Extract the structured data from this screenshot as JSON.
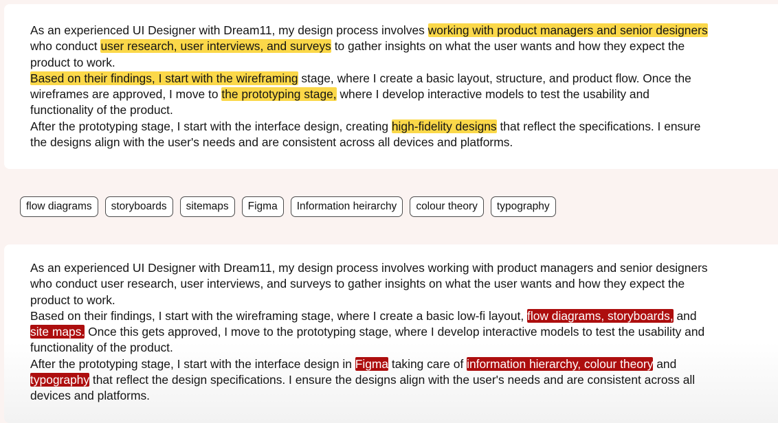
{
  "top": {
    "lines": [
      {
        "segments": [
          {
            "t": "As an experienced UI Designer with Dream11, my design process involves "
          },
          {
            "t": "working with product managers and senior designers",
            "h": "y"
          }
        ]
      },
      {
        "segments": [
          {
            "t": "who conduct "
          },
          {
            "t": "user research, user interviews, and surveys",
            "h": "y"
          },
          {
            "t": " to gather insights on what the user wants and how they expect the"
          }
        ]
      },
      {
        "segments": [
          {
            "t": "product to work."
          }
        ]
      },
      {
        "segments": [
          {
            "t": "Based on their findings, I start with the wireframing",
            "h": "y"
          },
          {
            "t": " stage, where I create a basic layout, structure, and product flow. Once the"
          }
        ]
      },
      {
        "segments": [
          {
            "t": "wireframes are approved, I move to "
          },
          {
            "t": "the prototyping stage,",
            "h": "y"
          },
          {
            "t": " where I develop interactive models to test the usability and"
          }
        ]
      },
      {
        "segments": [
          {
            "t": "functionality of the product."
          }
        ]
      },
      {
        "segments": [
          {
            "t": "After the prototyping stage, I start with the interface design, creating "
          },
          {
            "t": "high-fidelity designs",
            "h": "y"
          },
          {
            "t": " that reflect the specifications. I ensure"
          }
        ]
      },
      {
        "segments": [
          {
            "t": "the designs align with the user's needs and are consistent across all devices and platforms."
          }
        ]
      }
    ]
  },
  "chips": [
    "flow diagrams",
    "storyboards",
    "sitemaps",
    "Figma",
    "Information heirarchy",
    "colour theory",
    "typography"
  ],
  "bottom": {
    "lines": [
      {
        "segments": [
          {
            "t": "As an experienced UI Designer with Dream11, my design process involves working with product managers and senior designers"
          }
        ]
      },
      {
        "segments": [
          {
            "t": "who conduct user research, user interviews, and surveys to gather insights on what the user wants and how they expect the"
          }
        ]
      },
      {
        "segments": [
          {
            "t": "product to work."
          }
        ]
      },
      {
        "segments": [
          {
            "t": "Based on their findings, I start with the wireframing stage, where I create a basic low-fi layout, "
          },
          {
            "t": "flow diagrams, storyboards,",
            "h": "r"
          },
          {
            "t": " and"
          }
        ]
      },
      {
        "segments": [
          {
            "t": "site maps.",
            "h": "r"
          },
          {
            "t": " Once this gets approved, I move to the prototyping stage, where I develop interactive models to test the usability and"
          }
        ]
      },
      {
        "segments": [
          {
            "t": "functionality of the product."
          }
        ]
      },
      {
        "segments": [
          {
            "t": "After the prototyping stage, I start with the interface design in "
          },
          {
            "t": "Figma",
            "h": "r"
          },
          {
            "t": " taking care of "
          },
          {
            "t": "information hierarchy, colour theory",
            "h": "r"
          },
          {
            "t": " and"
          }
        ]
      },
      {
        "segments": [
          {
            "t": "typography",
            "h": "r"
          },
          {
            "t": " that reflect the design specifications. I ensure the designs align with the user's needs and are consistent across all"
          }
        ]
      },
      {
        "segments": [
          {
            "t": "devices and platforms."
          }
        ]
      }
    ]
  },
  "colors": {
    "highlight_yellow": "#fbd849",
    "highlight_red": "#ad0e0e",
    "background": "#fbf3f1"
  }
}
